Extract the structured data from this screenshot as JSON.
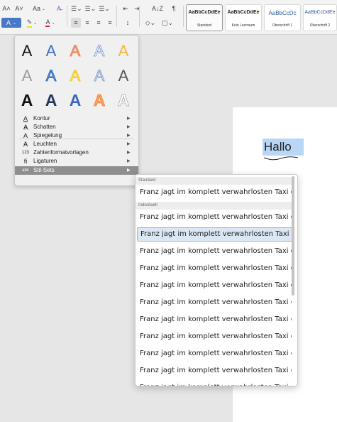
{
  "ribbon": {
    "font_grow": "A˄",
    "font_shrink": "A˅",
    "case_label": "Aa",
    "clear_format": "A̶",
    "line_spacing": "↕",
    "pilcrow": "¶",
    "sort": "A↓Z",
    "styles": [
      {
        "sample": "AaBbCcDdEe",
        "caption": "Standard"
      },
      {
        "sample": "AaBbCcDdEe",
        "caption": "Kein Leerraum"
      },
      {
        "sample": "AaBbCcDc",
        "caption": "Überschrift 1"
      },
      {
        "sample": "AaBbCcDdEe",
        "caption": "Überschrift 2"
      }
    ]
  },
  "document": {
    "text": "Hallo"
  },
  "text_effects_menu": {
    "effect_letter": "A",
    "items": [
      {
        "icon": "A",
        "label": "Kontur"
      },
      {
        "icon": "A",
        "label": "Schatten"
      },
      {
        "icon": "A",
        "label": "Spiegelung"
      },
      {
        "icon": "A",
        "label": "Leuchten"
      },
      {
        "icon": "123",
        "label": "Zahlenformatvorlagen"
      },
      {
        "icon": "fi",
        "label": "Ligaturen"
      },
      {
        "icon": "abc",
        "label": "Stil-Sets"
      }
    ]
  },
  "stylesets_submenu": {
    "header_standard": "Standard",
    "header_individual": "Individuell",
    "sample_text": "Franz jagt im komplett verwahrlosten Taxi qu",
    "rows": [
      "Franz jagt im komplett verwahrlosten Taxi qu",
      "Franz jagt im komplett verwahrlosten Taxi qu",
      "Franz jagt im komplett verwahrlosten Taxi qu",
      "Franz jagt im komplett verwahrlosten Taxi qu",
      "Franz jagt im komplett verwahrlosten Taxi qu",
      "Franz jagt im komplett verwahrlosten Taxi qu",
      "Franz jagt im komplett verwahrlosten Taxi qu",
      "Franz jagt im komplett verwahrlosten Taxi qu",
      "Franz jagt im komplett verwahrlosten Taxi qu",
      "Franz jagt im komplett verwahrlosten Taxi qu",
      "Franz jagt im komplett verwahrlosten Taxi qu",
      "Franz jagt im komplett verwahrlosten Taxi qu"
    ]
  },
  "colors": {
    "selection": "#b9d6f7",
    "active_menu_item": "#8e8e8e",
    "ribbon_bg": "#f3f3f3"
  }
}
